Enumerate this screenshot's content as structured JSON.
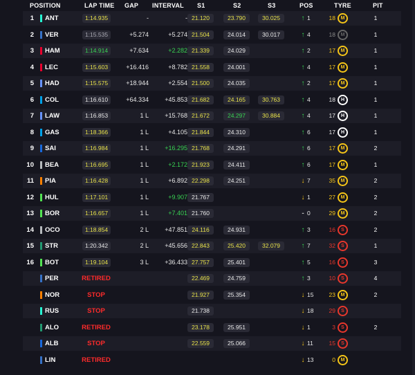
{
  "headers": {
    "position": "POSITION",
    "lap_time": "LAP TIME",
    "gap": "GAP",
    "interval": "INTERVAL",
    "s1": "S1",
    "s2": "S2",
    "s3": "S3",
    "pos": "POS",
    "tyre": "TYRE",
    "pit": "PIT"
  },
  "colors": {
    "tyre_medium": "#f5c518",
    "tyre_hard": "#ffffff",
    "tyre_soft": "#e8372c",
    "arrow_up": "#39d353",
    "arrow_down": "#f5c518"
  },
  "rows": [
    {
      "pos": "1",
      "team": "#27f4d2",
      "driver": "ANT",
      "lap": "1:14.935",
      "lapc": "y",
      "gap": "-",
      "int": "-",
      "intc": "w",
      "s1": "21.120",
      "s1c": "y",
      "s2": "23.790",
      "s2c": "y",
      "s3": "30.025",
      "s3c": "y",
      "dir": "up",
      "pch": "1",
      "laps": "18",
      "lapsc": "dn",
      "tyre": "M",
      "pit": "1"
    },
    {
      "pos": "2",
      "team": "#3671c6",
      "driver": "VER",
      "lap": "1:15.535",
      "lapc": "gr",
      "gap": "+5.274",
      "int": "+5.274",
      "intc": "w",
      "s1": "21.504",
      "s1c": "y",
      "s2": "24.014",
      "s2c": "w",
      "s3": "30.017",
      "s3c": "w",
      "dir": "up",
      "pch": "4",
      "laps": "18",
      "lapsc": "gr",
      "tyre": "M",
      "tyredim": true,
      "pit": "1"
    },
    {
      "pos": "3",
      "team": "#e8002d",
      "driver": "HAM",
      "lap": "1:14.914",
      "lapc": "g",
      "gap": "+7.634",
      "int": "+2.282",
      "intc": "g",
      "s1": "21.339",
      "s1c": "y",
      "s2": "24.029",
      "s2c": "w",
      "s3": "",
      "dir": "up",
      "pch": "2",
      "laps": "17",
      "lapsc": "dn",
      "tyre": "M",
      "pit": "1"
    },
    {
      "pos": "4",
      "team": "#e8002d",
      "driver": "LEC",
      "lap": "1:15.603",
      "lapc": "y",
      "gap": "+16.416",
      "int": "+8.782",
      "intc": "w",
      "s1": "21.558",
      "s1c": "y",
      "s2": "24.001",
      "s2c": "w",
      "s3": "",
      "dir": "up",
      "pch": "4",
      "laps": "17",
      "lapsc": "dn",
      "tyre": "M",
      "pit": "1"
    },
    {
      "pos": "5",
      "team": "#6692ff",
      "driver": "HAD",
      "lap": "1:15.575",
      "lapc": "y",
      "gap": "+18.944",
      "int": "+2.554",
      "intc": "w",
      "s1": "21.500",
      "s1c": "y",
      "s2": "24.035",
      "s2c": "w",
      "s3": "",
      "dir": "up",
      "pch": "2",
      "laps": "17",
      "lapsc": "dn",
      "tyre": "M",
      "pit": "1"
    },
    {
      "pos": "6",
      "team": "#00a1e8",
      "driver": "COL",
      "lap": "1:16.610",
      "lapc": "w",
      "gap": "+64.334",
      "int": "+45.853",
      "intc": "w",
      "s1": "21.682",
      "s1c": "y",
      "s2": "24.165",
      "s2c": "y",
      "s3": "30.763",
      "s3c": "y",
      "dir": "up",
      "pch": "4",
      "laps": "18",
      "lapsc": "w",
      "tyre": "H",
      "pit": "1"
    },
    {
      "pos": "7",
      "team": "#6692ff",
      "driver": "LAW",
      "lap": "1:16.853",
      "lapc": "w",
      "gap": "1 L",
      "int": "+15.768",
      "intc": "w",
      "s1": "21.672",
      "s1c": "y",
      "s2": "24.297",
      "s2c": "g",
      "s3": "30.884",
      "s3c": "y",
      "dir": "up",
      "pch": "4",
      "laps": "17",
      "lapsc": "w",
      "tyre": "H",
      "pit": "1"
    },
    {
      "pos": "8",
      "team": "#00a1e8",
      "driver": "GAS",
      "lap": "1:18.366",
      "lapc": "y",
      "gap": "1 L",
      "int": "+4.105",
      "intc": "w",
      "s1": "21.844",
      "s1c": "y",
      "s2": "24.310",
      "s2c": "w",
      "s3": "",
      "dir": "up",
      "pch": "6",
      "laps": "17",
      "lapsc": "w",
      "tyre": "H",
      "pit": "1"
    },
    {
      "pos": "9",
      "team": "#1868db",
      "driver": "SAI",
      "lap": "1:16.984",
      "lapc": "y",
      "gap": "1 L",
      "int": "+16.295",
      "intc": "g",
      "s1": "21.768",
      "s1c": "y",
      "s2": "24.291",
      "s2c": "w",
      "s3": "",
      "dir": "up",
      "pch": "6",
      "laps": "17",
      "lapsc": "dn",
      "tyre": "M",
      "pit": "2"
    },
    {
      "pos": "10",
      "team": "#b6babd",
      "driver": "BEA",
      "lap": "1:16.695",
      "lapc": "y",
      "gap": "1 L",
      "int": "+2.172",
      "intc": "g",
      "s1": "21.923",
      "s1c": "y",
      "s2": "24.411",
      "s2c": "w",
      "s3": "",
      "dir": "up",
      "pch": "6",
      "laps": "17",
      "lapsc": "dn",
      "tyre": "M",
      "pit": "1"
    },
    {
      "pos": "11",
      "team": "#ff8000",
      "driver": "PIA",
      "lap": "1:16.428",
      "lapc": "y",
      "gap": "1 L",
      "int": "+6.892",
      "intc": "w",
      "s1": "22.298",
      "s1c": "y",
      "s2": "24.251",
      "s2c": "w",
      "s3": "",
      "dir": "dn",
      "pch": "7",
      "laps": "35",
      "lapsc": "dn",
      "tyre": "M",
      "pit": "2"
    },
    {
      "pos": "12",
      "team": "#52e252",
      "driver": "HUL",
      "lap": "1:17.101",
      "lapc": "y",
      "gap": "1 L",
      "int": "+9.907",
      "intc": "g",
      "s1": "21.767",
      "s1c": "w",
      "s2": "",
      "s3": "",
      "dir": "dn",
      "pch": "1",
      "laps": "27",
      "lapsc": "dn",
      "tyre": "M",
      "pit": "2"
    },
    {
      "pos": "13",
      "team": "#52e252",
      "driver": "BOR",
      "lap": "1:16.657",
      "lapc": "y",
      "gap": "1 L",
      "int": "+7.401",
      "intc": "g",
      "s1": "21.760",
      "s1c": "w",
      "s2": "",
      "s3": "",
      "dir": "eq",
      "pch": "0",
      "laps": "29",
      "lapsc": "dn",
      "tyre": "M",
      "pit": "2"
    },
    {
      "pos": "14",
      "team": "#b6babd",
      "driver": "OCO",
      "lap": "1:18.854",
      "lapc": "y",
      "gap": "2 L",
      "int": "+47.851",
      "intc": "w",
      "s1": "24.116",
      "s1c": "y",
      "s2": "24.931",
      "s2c": "w",
      "s3": "",
      "dir": "up",
      "pch": "3",
      "laps": "16",
      "lapsc": "sr",
      "tyre": "S",
      "pit": "2"
    },
    {
      "pos": "15",
      "team": "#229971",
      "driver": "STR",
      "lap": "1:20.342",
      "lapc": "w",
      "gap": "2 L",
      "int": "+45.656",
      "intc": "w",
      "s1": "22.843",
      "s1c": "y",
      "s2": "25.420",
      "s2c": "y",
      "s3": "32.079",
      "s3c": "y",
      "dir": "up",
      "pch": "7",
      "laps": "32",
      "lapsc": "sr",
      "tyre": "S",
      "pit": "1"
    },
    {
      "pos": "16",
      "team": "#52e252",
      "driver": "BOT",
      "lap": "1:19.104",
      "lapc": "y",
      "gap": "3 L",
      "int": "+36.433",
      "intc": "w",
      "s1": "27.757",
      "s1c": "y",
      "s2": "25.401",
      "s2c": "w",
      "s3": "",
      "dir": "up",
      "pch": "5",
      "laps": "16",
      "lapsc": "sr",
      "tyre": "S",
      "pit": "3"
    },
    {
      "pos": "",
      "team": "#3671c6",
      "driver": "PER",
      "status": "RETIRED",
      "s1": "22.469",
      "s1c": "y",
      "s2": "24.759",
      "s2c": "w",
      "s3": "",
      "dir": "up",
      "pch": "3",
      "laps": "10",
      "lapsc": "sr",
      "tyre": "S",
      "pit": "4"
    },
    {
      "pos": "",
      "team": "#ff8000",
      "driver": "NOR",
      "status": "STOP",
      "s1": "21.927",
      "s1c": "y",
      "s2": "25.354",
      "s2c": "w",
      "s3": "",
      "dir": "dn",
      "pch": "15",
      "laps": "23",
      "lapsc": "dn",
      "tyre": "M",
      "pit": "2"
    },
    {
      "pos": "",
      "team": "#27f4d2",
      "driver": "RUS",
      "status": "STOP",
      "s1": "21.738",
      "s1c": "w",
      "s2": "",
      "s3": "",
      "dir": "dn",
      "pch": "18",
      "laps": "29",
      "lapsc": "sr",
      "tyre": "S",
      "pit": ""
    },
    {
      "pos": "",
      "team": "#229971",
      "driver": "ALO",
      "status": "RETIRED",
      "s1": "23.178",
      "s1c": "y",
      "s2": "25.951",
      "s2c": "w",
      "s3": "",
      "dir": "dn",
      "pch": "1",
      "laps": "3",
      "lapsc": "sr",
      "tyre": "S",
      "pit": "2"
    },
    {
      "pos": "",
      "team": "#1868db",
      "driver": "ALB",
      "status": "STOP",
      "s1": "22.559",
      "s1c": "y",
      "s2": "25.066",
      "s2c": "w",
      "s3": "",
      "dir": "dn",
      "pch": "11",
      "laps": "15",
      "lapsc": "sr",
      "tyre": "S",
      "pit": ""
    },
    {
      "pos": "",
      "team": "#3671c6",
      "driver": "LIN",
      "status": "RETIRED",
      "s1": "",
      "s2": "",
      "s3": "",
      "dir": "dn",
      "pch": "13",
      "laps": "0",
      "lapsc": "dn",
      "tyre": "M",
      "pit": ""
    }
  ]
}
